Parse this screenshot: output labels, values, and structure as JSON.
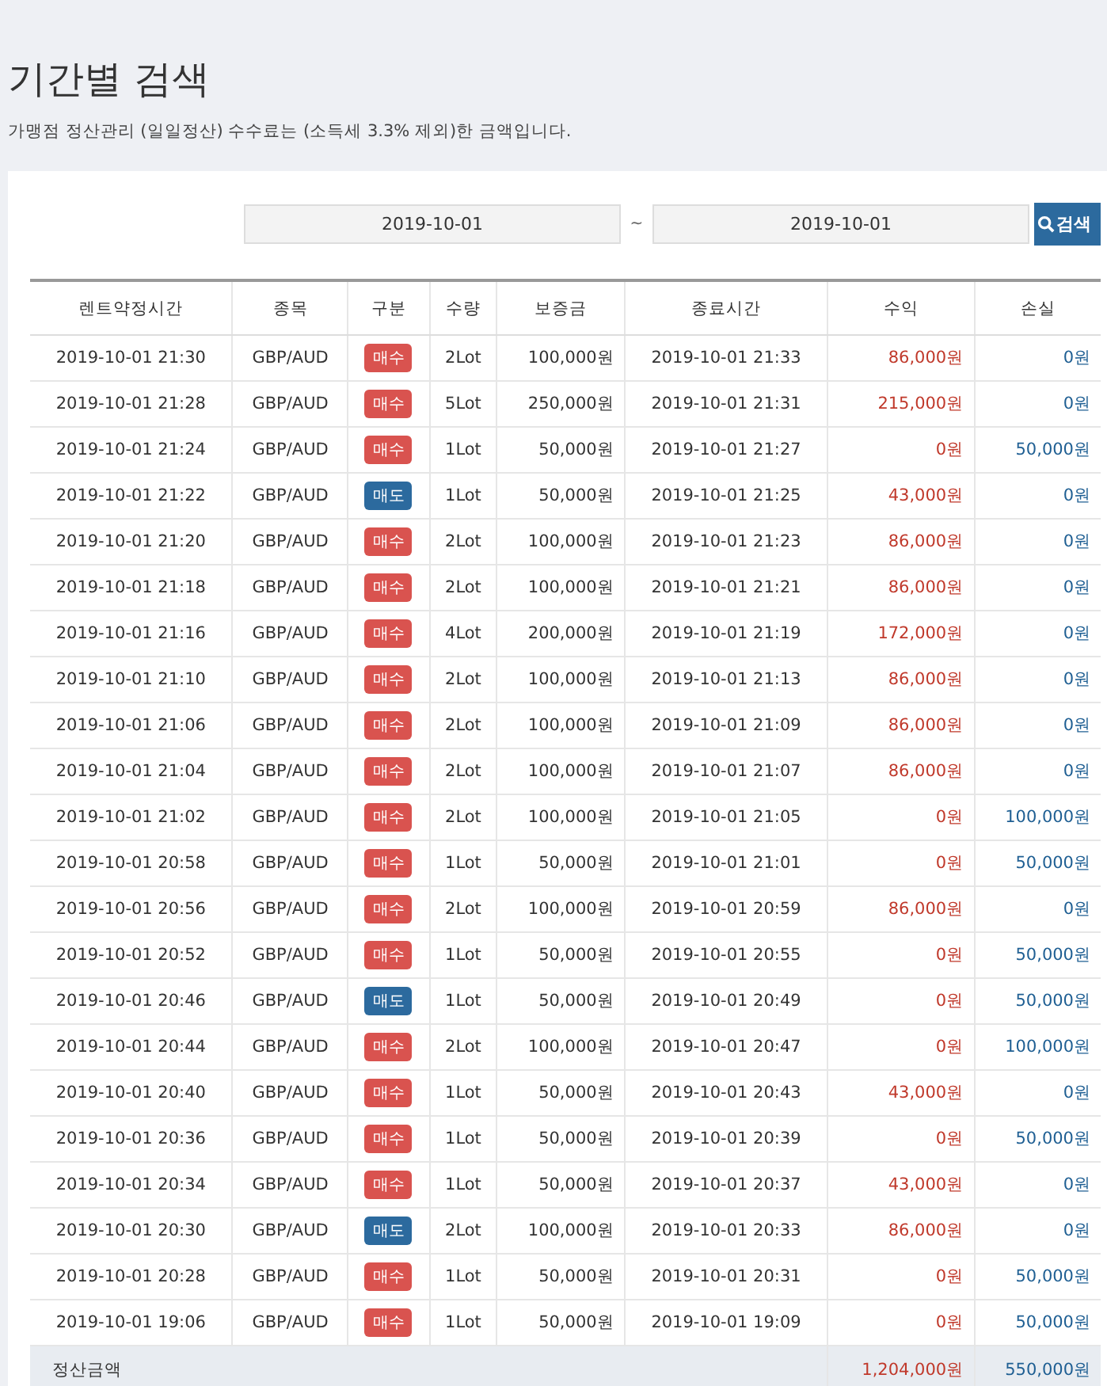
{
  "title": "기간별 검색",
  "description": "가맹점 정산관리 (일일정산) 수수료는 (소득세 3.3% 제외)한 금액입니다.",
  "search": {
    "date_from": "2019-10-01",
    "separator": "~",
    "date_to": "2019-10-01",
    "button": "검색"
  },
  "table": {
    "columns": [
      "렌트약정시간",
      "종목",
      "구분",
      "수량",
      "보증금",
      "종료시간",
      "수익",
      "손실"
    ],
    "rows": [
      {
        "start": "2019-10-01 21:30",
        "symbol": "GBP/AUD",
        "side": {
          "label": "매수",
          "kind": "buy"
        },
        "qty": "2Lot",
        "deposit": "100,000원",
        "end": "2019-10-01 21:33",
        "profit": "86,000원",
        "loss": "0원"
      },
      {
        "start": "2019-10-01 21:28",
        "symbol": "GBP/AUD",
        "side": {
          "label": "매수",
          "kind": "buy"
        },
        "qty": "5Lot",
        "deposit": "250,000원",
        "end": "2019-10-01 21:31",
        "profit": "215,000원",
        "loss": "0원"
      },
      {
        "start": "2019-10-01 21:24",
        "symbol": "GBP/AUD",
        "side": {
          "label": "매수",
          "kind": "buy"
        },
        "qty": "1Lot",
        "deposit": "50,000원",
        "end": "2019-10-01 21:27",
        "profit": "0원",
        "loss": "50,000원"
      },
      {
        "start": "2019-10-01 21:22",
        "symbol": "GBP/AUD",
        "side": {
          "label": "매도",
          "kind": "sell"
        },
        "qty": "1Lot",
        "deposit": "50,000원",
        "end": "2019-10-01 21:25",
        "profit": "43,000원",
        "loss": "0원"
      },
      {
        "start": "2019-10-01 21:20",
        "symbol": "GBP/AUD",
        "side": {
          "label": "매수",
          "kind": "buy"
        },
        "qty": "2Lot",
        "deposit": "100,000원",
        "end": "2019-10-01 21:23",
        "profit": "86,000원",
        "loss": "0원"
      },
      {
        "start": "2019-10-01 21:18",
        "symbol": "GBP/AUD",
        "side": {
          "label": "매수",
          "kind": "buy"
        },
        "qty": "2Lot",
        "deposit": "100,000원",
        "end": "2019-10-01 21:21",
        "profit": "86,000원",
        "loss": "0원"
      },
      {
        "start": "2019-10-01 21:16",
        "symbol": "GBP/AUD",
        "side": {
          "label": "매수",
          "kind": "buy"
        },
        "qty": "4Lot",
        "deposit": "200,000원",
        "end": "2019-10-01 21:19",
        "profit": "172,000원",
        "loss": "0원"
      },
      {
        "start": "2019-10-01 21:10",
        "symbol": "GBP/AUD",
        "side": {
          "label": "매수",
          "kind": "buy"
        },
        "qty": "2Lot",
        "deposit": "100,000원",
        "end": "2019-10-01 21:13",
        "profit": "86,000원",
        "loss": "0원"
      },
      {
        "start": "2019-10-01 21:06",
        "symbol": "GBP/AUD",
        "side": {
          "label": "매수",
          "kind": "buy"
        },
        "qty": "2Lot",
        "deposit": "100,000원",
        "end": "2019-10-01 21:09",
        "profit": "86,000원",
        "loss": "0원"
      },
      {
        "start": "2019-10-01 21:04",
        "symbol": "GBP/AUD",
        "side": {
          "label": "매수",
          "kind": "buy"
        },
        "qty": "2Lot",
        "deposit": "100,000원",
        "end": "2019-10-01 21:07",
        "profit": "86,000원",
        "loss": "0원"
      },
      {
        "start": "2019-10-01 21:02",
        "symbol": "GBP/AUD",
        "side": {
          "label": "매수",
          "kind": "buy"
        },
        "qty": "2Lot",
        "deposit": "100,000원",
        "end": "2019-10-01 21:05",
        "profit": "0원",
        "loss": "100,000원"
      },
      {
        "start": "2019-10-01 20:58",
        "symbol": "GBP/AUD",
        "side": {
          "label": "매수",
          "kind": "buy"
        },
        "qty": "1Lot",
        "deposit": "50,000원",
        "end": "2019-10-01 21:01",
        "profit": "0원",
        "loss": "50,000원"
      },
      {
        "start": "2019-10-01 20:56",
        "symbol": "GBP/AUD",
        "side": {
          "label": "매수",
          "kind": "buy"
        },
        "qty": "2Lot",
        "deposit": "100,000원",
        "end": "2019-10-01 20:59",
        "profit": "86,000원",
        "loss": "0원"
      },
      {
        "start": "2019-10-01 20:52",
        "symbol": "GBP/AUD",
        "side": {
          "label": "매수",
          "kind": "buy"
        },
        "qty": "1Lot",
        "deposit": "50,000원",
        "end": "2019-10-01 20:55",
        "profit": "0원",
        "loss": "50,000원"
      },
      {
        "start": "2019-10-01 20:46",
        "symbol": "GBP/AUD",
        "side": {
          "label": "매도",
          "kind": "sell"
        },
        "qty": "1Lot",
        "deposit": "50,000원",
        "end": "2019-10-01 20:49",
        "profit": "0원",
        "loss": "50,000원"
      },
      {
        "start": "2019-10-01 20:44",
        "symbol": "GBP/AUD",
        "side": {
          "label": "매수",
          "kind": "buy"
        },
        "qty": "2Lot",
        "deposit": "100,000원",
        "end": "2019-10-01 20:47",
        "profit": "0원",
        "loss": "100,000원"
      },
      {
        "start": "2019-10-01 20:40",
        "symbol": "GBP/AUD",
        "side": {
          "label": "매수",
          "kind": "buy"
        },
        "qty": "1Lot",
        "deposit": "50,000원",
        "end": "2019-10-01 20:43",
        "profit": "43,000원",
        "loss": "0원"
      },
      {
        "start": "2019-10-01 20:36",
        "symbol": "GBP/AUD",
        "side": {
          "label": "매수",
          "kind": "buy"
        },
        "qty": "1Lot",
        "deposit": "50,000원",
        "end": "2019-10-01 20:39",
        "profit": "0원",
        "loss": "50,000원"
      },
      {
        "start": "2019-10-01 20:34",
        "symbol": "GBP/AUD",
        "side": {
          "label": "매수",
          "kind": "buy"
        },
        "qty": "1Lot",
        "deposit": "50,000원",
        "end": "2019-10-01 20:37",
        "profit": "43,000원",
        "loss": "0원"
      },
      {
        "start": "2019-10-01 20:30",
        "symbol": "GBP/AUD",
        "side": {
          "label": "매도",
          "kind": "sell"
        },
        "qty": "2Lot",
        "deposit": "100,000원",
        "end": "2019-10-01 20:33",
        "profit": "86,000원",
        "loss": "0원"
      },
      {
        "start": "2019-10-01 20:28",
        "symbol": "GBP/AUD",
        "side": {
          "label": "매수",
          "kind": "buy"
        },
        "qty": "1Lot",
        "deposit": "50,000원",
        "end": "2019-10-01 20:31",
        "profit": "0원",
        "loss": "50,000원"
      },
      {
        "start": "2019-10-01 19:06",
        "symbol": "GBP/AUD",
        "side": {
          "label": "매수",
          "kind": "buy"
        },
        "qty": "1Lot",
        "deposit": "50,000원",
        "end": "2019-10-01 19:09",
        "profit": "0원",
        "loss": "50,000원"
      }
    ],
    "total": {
      "label": "정산금액",
      "profit": "1,204,000원",
      "loss": "550,000원"
    }
  }
}
